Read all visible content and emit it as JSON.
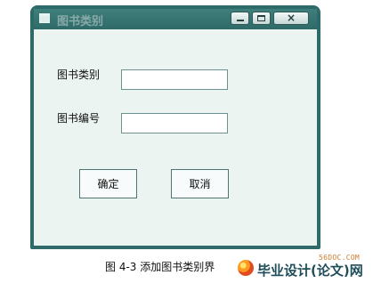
{
  "window": {
    "title": "图书类别"
  },
  "form": {
    "category_label": "图书类别",
    "number_label": "图书编号",
    "category_value": "",
    "number_value": ""
  },
  "buttons": {
    "confirm_label": "确定",
    "cancel_label": "取消"
  },
  "caption": "图 4-3 添加图书类别界",
  "watermark": {
    "domain": "56DOC.COM",
    "text": "毕业设计(论文)网"
  },
  "icons": [
    "window-app-icon",
    "minimize-icon",
    "maximize-icon",
    "close-icon"
  ],
  "colors": {
    "titlebar": "#2e6a68",
    "window_background": "#ecf4f2",
    "border": "#2e6a68"
  }
}
